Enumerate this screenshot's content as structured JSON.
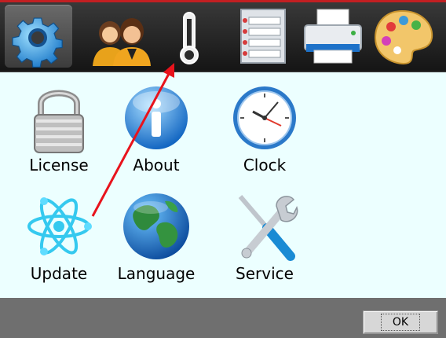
{
  "toolbar": {
    "tabs": [
      {
        "icon": "gear-icon",
        "active": true
      },
      {
        "icon": "users-icon",
        "active": false
      },
      {
        "icon": "thermometer-icon",
        "active": false
      },
      {
        "icon": "list-icon",
        "active": false
      },
      {
        "icon": "printer-icon",
        "active": false
      },
      {
        "icon": "palette-icon",
        "active": false
      }
    ]
  },
  "main": {
    "items": [
      {
        "label": "License",
        "icon": "lock-icon"
      },
      {
        "label": "About",
        "icon": "info-icon"
      },
      {
        "label": "Clock",
        "icon": "clock-icon"
      },
      {
        "label": "Update",
        "icon": "atom-icon"
      },
      {
        "label": "Language",
        "icon": "globe-icon"
      },
      {
        "label": "Service",
        "icon": "tools-icon"
      }
    ]
  },
  "footer": {
    "ok_label": "OK"
  },
  "annotation": {
    "color": "#e8131c"
  }
}
